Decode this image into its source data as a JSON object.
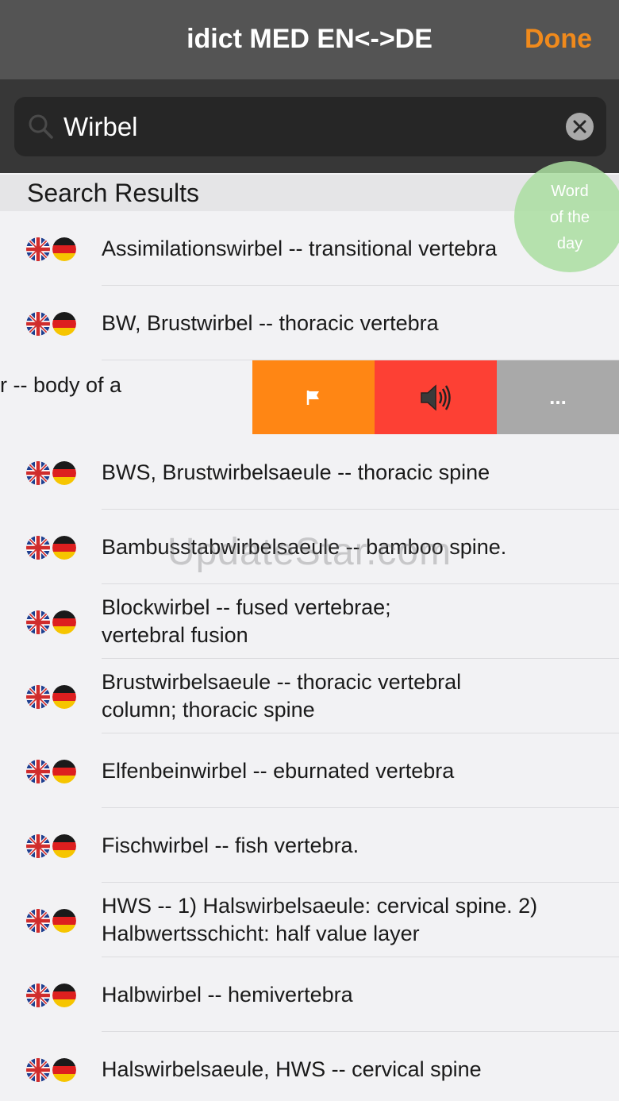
{
  "navbar": {
    "title": "idict MED EN<->DE",
    "done_label": "Done"
  },
  "search": {
    "value": "Wirbel"
  },
  "section": {
    "title": "Search Results"
  },
  "word_of_day": {
    "line1": "Word",
    "line2": "of the",
    "line3": "day"
  },
  "swiped_row": {
    "text": "r -- body of a",
    "more_label": "..."
  },
  "results": [
    {
      "text": "Assimilationswirbel -- transitional vertebra"
    },
    {
      "text": "BW, Brustwirbel -- thoracic vertebra"
    },
    {
      "text": "BWS, Brustwirbelsaeule -- thoracic spine"
    },
    {
      "text": "Bambusstabwirbelsaeule -- bamboo spine."
    },
    {
      "text": "Blockwirbel -- fused vertebrae;\nvertebral fusion"
    },
    {
      "text": "Brustwirbelsaeule -- thoracic vertebral\ncolumn; thoracic spine"
    },
    {
      "text": "Elfenbeinwirbel -- eburnated vertebra"
    },
    {
      "text": "Fischwirbel -- fish vertebra."
    },
    {
      "text": "HWS -- 1) Halswirbelsaeule: cervical spine. 2)\nHalbwertsschicht: half value layer"
    },
    {
      "text": "Halbwirbel -- hemivertebra"
    },
    {
      "text": "Halswirbelsaeule, HWS -- cervical spine"
    }
  ],
  "watermark": "UpdateStar.com",
  "colors": {
    "accent": "#f08a1c",
    "flag_action": "#ff8614",
    "sound_action": "#fd4034",
    "more_action": "#a9a9a9"
  },
  "icons": {
    "search": "magnifier-icon",
    "clear": "clear-x-icon",
    "flag": "flag-icon",
    "sound": "speaker-icon",
    "language": "uk-de-flags-icon"
  }
}
